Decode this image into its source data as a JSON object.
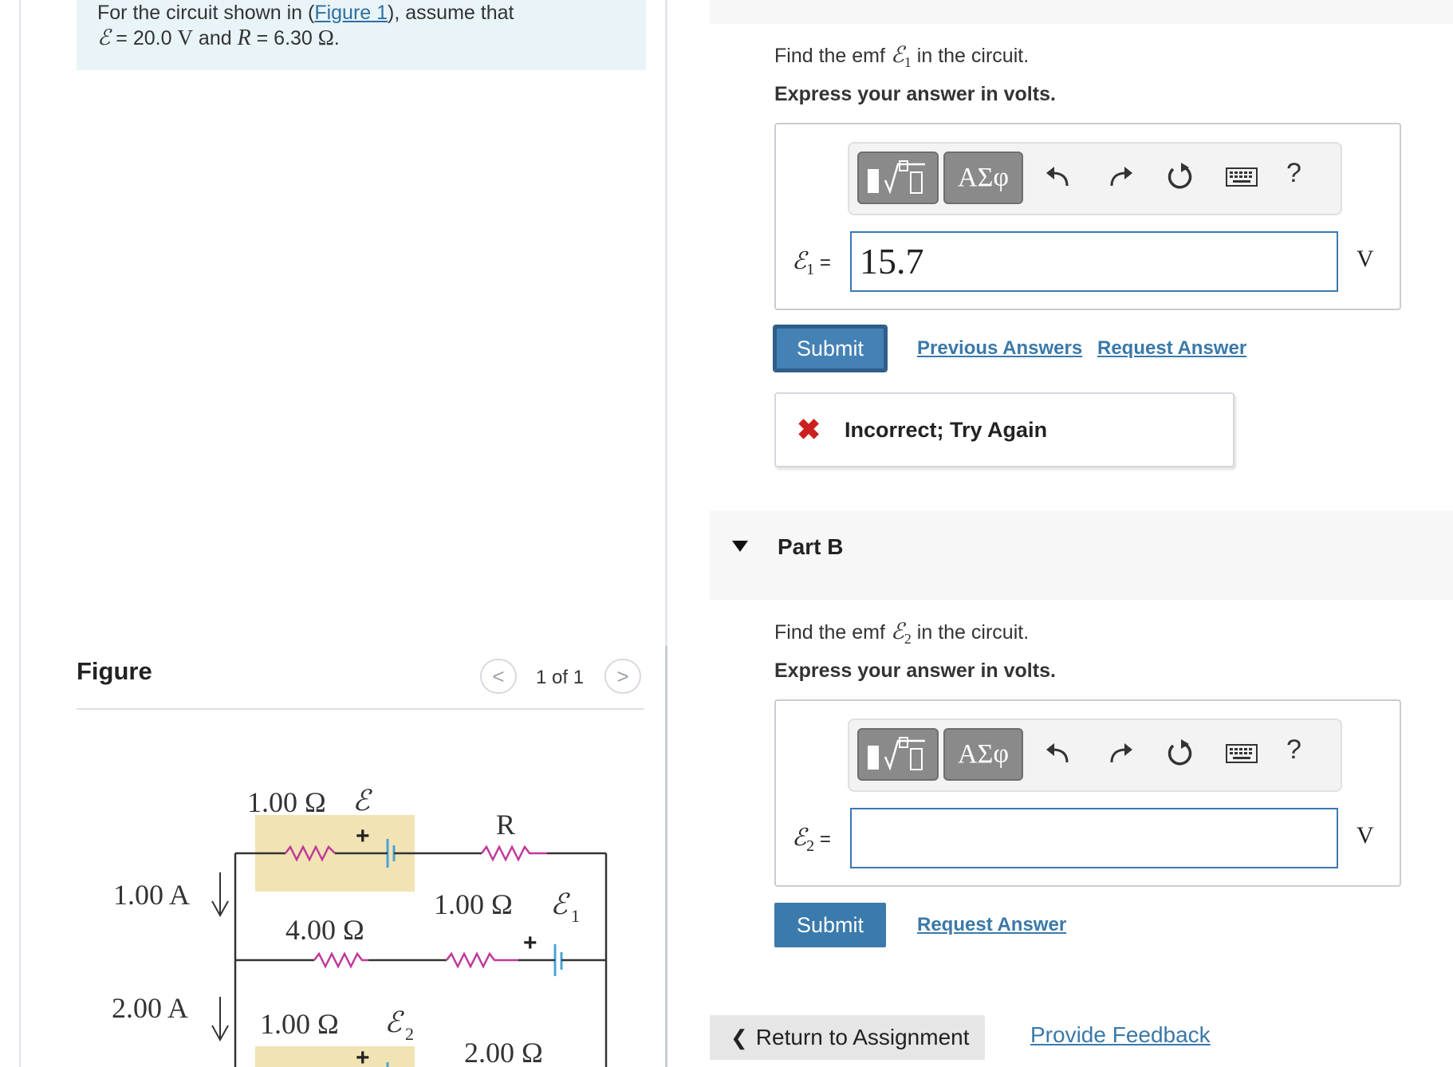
{
  "problem": {
    "line1_before": "For the circuit shown in (",
    "figure_link": "Figure 1",
    "line1_after": "), assume that",
    "emf_symbol": "ℰ",
    "line2_eq1": " = 20.0 ",
    "unit_v": "V",
    "and": " and ",
    "r_symbol": "R",
    "line2_eq2": " = 6.30 ",
    "unit_ohm": "Ω",
    "period": "."
  },
  "figure": {
    "title": "Figure",
    "pager_text": "1 of 1",
    "prev_glyph": "<",
    "next_glyph": ">"
  },
  "circuit": {
    "top_left_resistor": "1.00 Ω",
    "top_emf": "ℰ",
    "top_right_resistor": "R",
    "middle_left_resistor": "4.00 Ω",
    "middle_right_resistor": "1.00 Ω",
    "emf1_symbol": "ℰ",
    "emf1_sub": "1",
    "bottom_left_resistor": "1.00 Ω",
    "emf2_symbol": "ℰ",
    "emf2_sub": "2",
    "bottom_right_resistor": "2.00 Ω",
    "current_top": "1.00 A",
    "current_bottom": "2.00 A",
    "plus": "+",
    "colors": {
      "resistor": "#c0399a",
      "battery": "#4aa3d8",
      "highlight": "#f2e3b4",
      "wire": "#333333"
    }
  },
  "partA": {
    "question_before": "Find the emf ",
    "emf_symbol": "ℰ",
    "emf_sub": "1",
    "question_after": " in the circuit.",
    "instruction": "Express your answer in volts.",
    "var_label_symbol": "ℰ",
    "var_label_sub": "1",
    "var_label_eq": " =",
    "answer_value": "15.7",
    "unit": "V",
    "submit_label": "Submit",
    "previous_answers": "Previous Answers",
    "request_answer": "Request Answer",
    "feedback_icon": "✖",
    "feedback_text": "Incorrect; Try Again"
  },
  "toolbar": {
    "greek_label": "ΑΣφ",
    "help_label": "?",
    "icons": [
      "template-icon",
      "greek-icon",
      "undo-icon",
      "redo-icon",
      "reset-icon",
      "keyboard-icon",
      "help-icon"
    ]
  },
  "partB": {
    "title": "Part B",
    "question_before": "Find the emf ",
    "emf_symbol": "ℰ",
    "emf_sub": "2",
    "question_after": " in the circuit.",
    "instruction": "Express your answer in volts.",
    "var_label_symbol": "ℰ",
    "var_label_sub": "2",
    "var_label_eq": " =",
    "answer_value": "",
    "unit": "V",
    "submit_label": "Submit",
    "request_answer": "Request Answer"
  },
  "footer": {
    "return_chevron": "❮",
    "return_label": "Return to Assignment",
    "feedback_label": "Provide Feedback"
  }
}
